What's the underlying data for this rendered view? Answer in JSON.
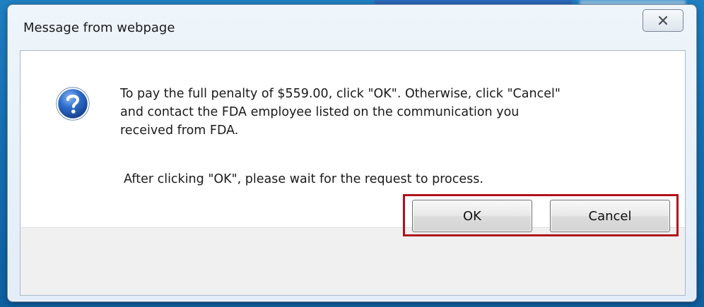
{
  "window": {
    "title": "Message from webpage"
  },
  "dialog": {
    "message_line1": "To pay the full penalty of $559.00, click \"OK\". Otherwise, click \"Cancel\"",
    "message_line2": "and contact the FDA employee listed on the communication you",
    "message_line3": "received from FDA.",
    "message_note": "After clicking \"OK\", please wait for the request to process.",
    "icon": "question-icon"
  },
  "buttons": {
    "ok_label": "OK",
    "cancel_label": "Cancel"
  },
  "colors": {
    "highlight_border": "#b0121b",
    "icon_blue": "#1f5bb5"
  }
}
